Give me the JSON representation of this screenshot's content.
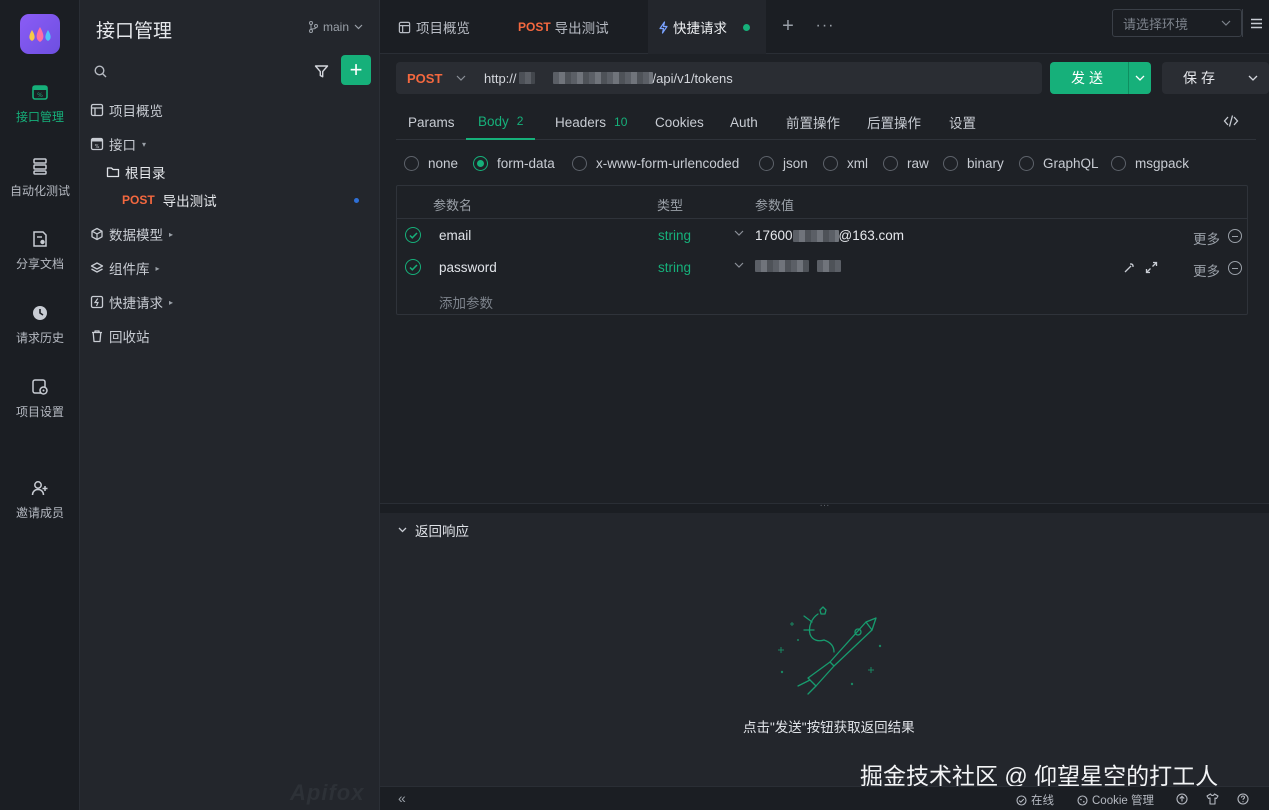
{
  "rail": {
    "items": [
      {
        "label": "接口管理",
        "icon": "api-icon",
        "active": true
      },
      {
        "label": "自动化测试",
        "icon": "automation-icon"
      },
      {
        "label": "分享文档",
        "icon": "share-doc-icon"
      },
      {
        "label": "请求历史",
        "icon": "history-icon"
      },
      {
        "label": "项目设置",
        "icon": "settings-icon"
      },
      {
        "label": "邀请成员",
        "icon": "invite-user-icon"
      }
    ]
  },
  "sidebar": {
    "title": "接口管理",
    "branch": "main",
    "search_placeholder": "",
    "add_label": "+",
    "tree": [
      {
        "label": "项目概览",
        "icon": "overview-icon"
      },
      {
        "label": "接口",
        "icon": "api-folder-icon",
        "arrow": "▾"
      },
      {
        "label": "根目录",
        "icon": "folder-icon"
      },
      {
        "method": "POST",
        "label": "导出测试"
      },
      {
        "label": "数据模型",
        "icon": "data-model-icon",
        "arrow": "▸"
      },
      {
        "label": "组件库",
        "icon": "component-icon",
        "arrow": "▸"
      },
      {
        "label": "快捷请求",
        "icon": "quick-request-icon",
        "arrow": "▸"
      },
      {
        "label": "回收站",
        "icon": "trash-icon"
      }
    ],
    "watermark": "Apifox"
  },
  "tabs": {
    "items": [
      {
        "label": "项目概览"
      },
      {
        "method": "POST",
        "label": "导出测试"
      },
      {
        "label": "快捷请求",
        "active": true
      }
    ],
    "env_placeholder": "请选择环境"
  },
  "request": {
    "method": "POST",
    "url_prefix": "http://",
    "url_suffix": "/api/v1/tokens",
    "send_label": "发送",
    "save_label": "保存"
  },
  "req_tabs": [
    {
      "label": "Params"
    },
    {
      "label": "Body",
      "count": "2",
      "active": true
    },
    {
      "label": "Headers",
      "count": "10"
    },
    {
      "label": "Cookies"
    },
    {
      "label": "Auth"
    },
    {
      "label": "前置操作"
    },
    {
      "label": "后置操作"
    },
    {
      "label": "设置"
    }
  ],
  "body_types": [
    {
      "label": "none"
    },
    {
      "label": "form-data",
      "selected": true
    },
    {
      "label": "x-www-form-urlencoded"
    },
    {
      "label": "json"
    },
    {
      "label": "xml"
    },
    {
      "label": "raw"
    },
    {
      "label": "binary"
    },
    {
      "label": "GraphQL"
    },
    {
      "label": "msgpack"
    }
  ],
  "params": {
    "headers": {
      "name": "参数名",
      "type": "类型",
      "value": "参数值"
    },
    "rows": [
      {
        "name": "email",
        "type": "string",
        "value_prefix": "17600",
        "value_suffix": "@163.com",
        "more": "更多"
      },
      {
        "name": "password",
        "type": "string",
        "value_prefix": "",
        "value_suffix": "",
        "more": "更多"
      }
    ],
    "add_placeholder": "添加参数"
  },
  "response": {
    "header": "返回响应",
    "empty_text": "点击\"发送\"按钮获取返回结果"
  },
  "overlay": {
    "community": "掘金技术社区 @ 仰望星空的打工人"
  },
  "statusbar": {
    "online": "在线",
    "cookie": "Cookie 管理"
  },
  "colors": {
    "accent": "#16b07a",
    "post": "#f4683f",
    "background": "#1e2126"
  }
}
